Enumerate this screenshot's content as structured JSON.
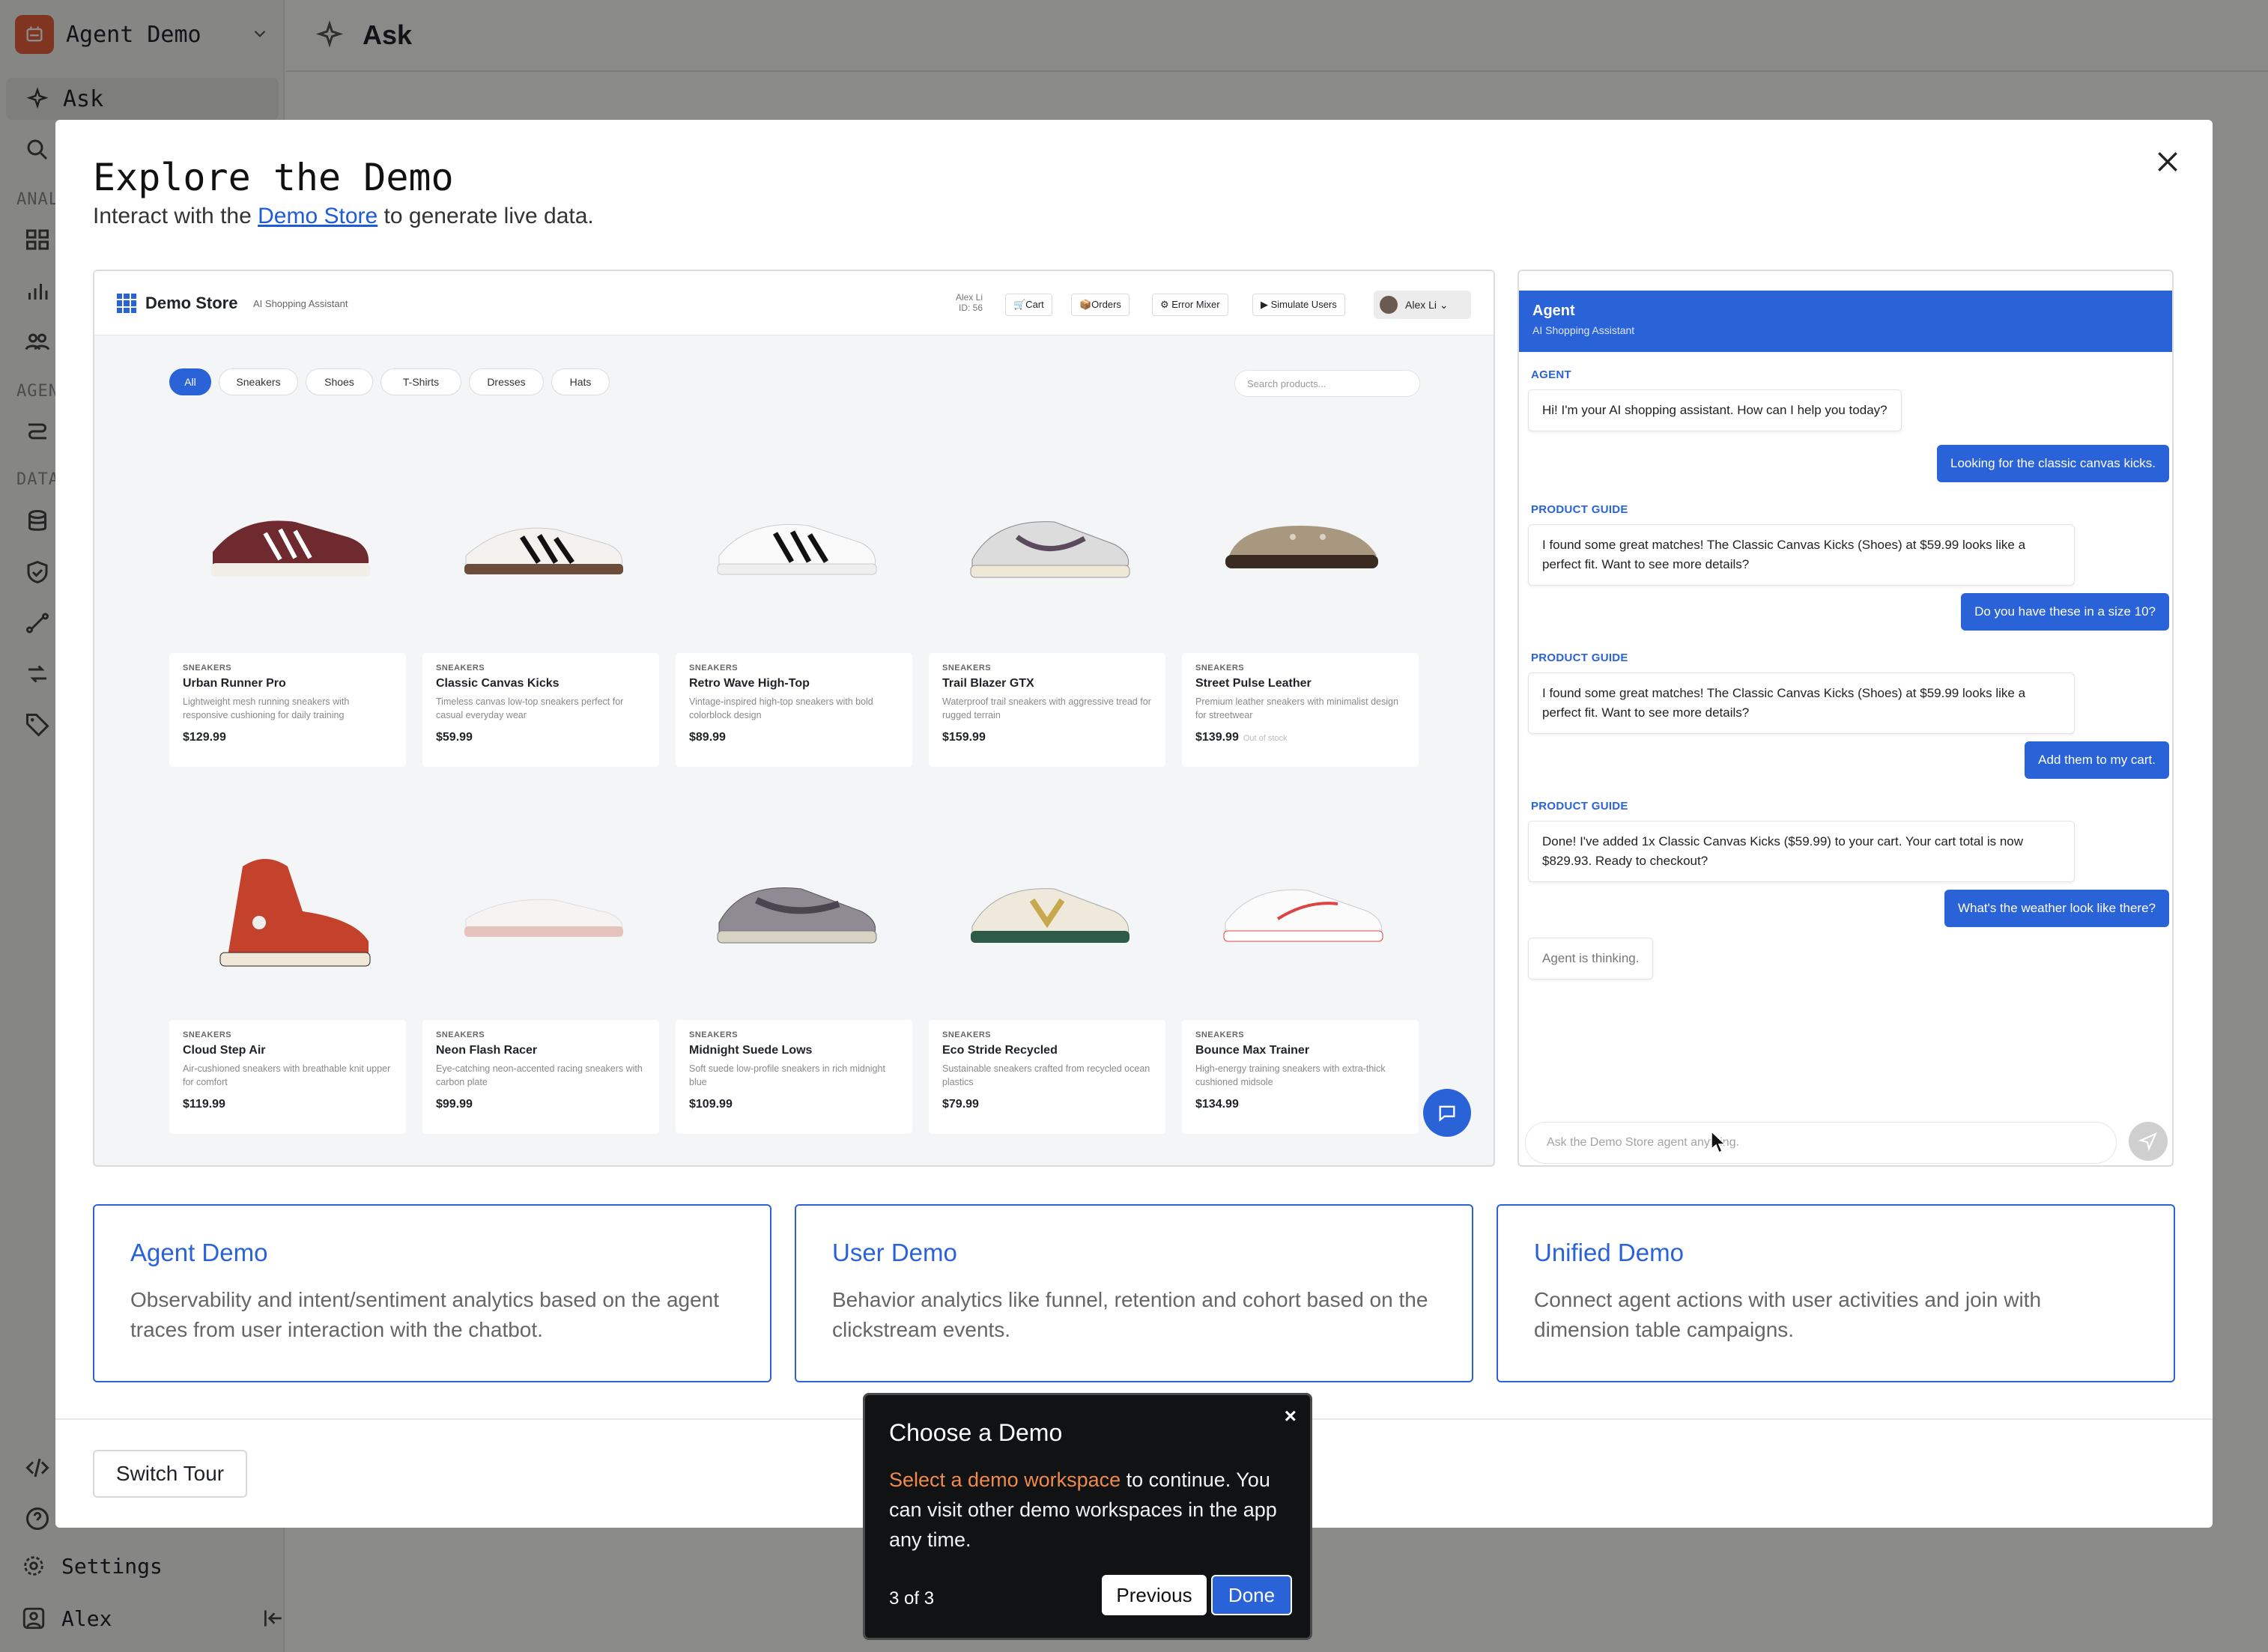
{
  "app": {
    "workspace_name": "Agent Demo",
    "page_title": "Ask",
    "sidebar": {
      "ask_label": "Ask",
      "section_analytics": "ANAL",
      "section_agents": "AGEN",
      "section_data": "DATA",
      "settings_label": "Settings",
      "user_name": "Alex"
    }
  },
  "modal": {
    "title": "Explore the Demo",
    "subtitle_prefix": "Interact with the",
    "subtitle_link": "Demo Store",
    "subtitle_suffix": "to generate live data.",
    "switch_tour_label": "Switch Tour"
  },
  "store": {
    "name": "Demo Store",
    "tagline": "AI Shopping Assistant",
    "user_info_name": "Alex Li",
    "user_info_id": "ID: 56",
    "buttons": [
      "🛒Cart",
      "📦Orders",
      "⚙ Error Mixer",
      "▶ Simulate Users"
    ],
    "profile_name": "Alex Li ⌄",
    "categories": [
      "All",
      "Sneakers",
      "Shoes",
      "T-Shirts",
      "Dresses",
      "Hats"
    ],
    "search_placeholder": "Search products...",
    "products": [
      {
        "category": "SNEAKERS",
        "name": "Urban Runner Pro",
        "desc": "Lightweight mesh running sneakers with responsive cushioning for daily training",
        "price": "$129.99",
        "stock": ""
      },
      {
        "category": "SNEAKERS",
        "name": "Classic Canvas Kicks",
        "desc": "Timeless canvas low-top sneakers perfect for casual everyday wear",
        "price": "$59.99",
        "stock": ""
      },
      {
        "category": "SNEAKERS",
        "name": "Retro Wave High-Top",
        "desc": "Vintage-inspired high-top sneakers with bold colorblock design",
        "price": "$89.99",
        "stock": ""
      },
      {
        "category": "SNEAKERS",
        "name": "Trail Blazer GTX",
        "desc": "Waterproof trail sneakers with aggressive tread for rugged terrain",
        "price": "$159.99",
        "stock": ""
      },
      {
        "category": "SNEAKERS",
        "name": "Street Pulse Leather",
        "desc": "Premium leather sneakers with minimalist design for streetwear",
        "price": "$139.99",
        "stock": "Out of stock"
      },
      {
        "category": "SNEAKERS",
        "name": "Cloud Step Air",
        "desc": "Air-cushioned sneakers with breathable knit upper for comfort",
        "price": "$119.99",
        "stock": ""
      },
      {
        "category": "SNEAKERS",
        "name": "Neon Flash Racer",
        "desc": "Eye-catching neon-accented racing sneakers with carbon plate",
        "price": "$99.99",
        "stock": ""
      },
      {
        "category": "SNEAKERS",
        "name": "Midnight Suede Lows",
        "desc": "Soft suede low-profile sneakers in rich midnight blue",
        "price": "$109.99",
        "stock": ""
      },
      {
        "category": "SNEAKERS",
        "name": "Eco Stride Recycled",
        "desc": "Sustainable sneakers crafted from recycled ocean plastics",
        "price": "$79.99",
        "stock": ""
      },
      {
        "category": "SNEAKERS",
        "name": "Bounce Max Trainer",
        "desc": "High-energy training sneakers with extra-thick cushioned midsole",
        "price": "$134.99",
        "stock": ""
      }
    ]
  },
  "chat": {
    "header_title": "Agent",
    "header_sub": "AI Shopping Assistant",
    "label_agent": "AGENT",
    "label_guide": "PRODUCT GUIDE",
    "m1": "Hi! I'm your AI shopping assistant. How can I help you today?",
    "u1": "Looking for the classic canvas kicks.",
    "m2": "I found some great matches! The Classic Canvas Kicks (Shoes) at $59.99 looks like a perfect fit. Want to see more details?",
    "u2": "Do you have these in a size 10?",
    "m3": "I found some great matches! The Classic Canvas Kicks (Shoes) at $59.99 looks like a perfect fit. Want to see more details?",
    "u3": "Add them to my cart.",
    "m4": "Done! I've added 1x Classic Canvas Kicks ($59.99) to your cart. Your cart total is now $829.93. Ready to checkout?",
    "u4": "What's the weather look like there?",
    "thinking": "Agent is thinking.",
    "input_placeholder": "Ask the Demo Store agent anything."
  },
  "demos": [
    {
      "title": "Agent Demo",
      "desc": "Observability and intent/sentiment analytics based on the agent traces from user interaction with the chatbot."
    },
    {
      "title": "User Demo",
      "desc": "Behavior analytics like funnel, retention and cohort based on the clickstream events."
    },
    {
      "title": "Unified Demo",
      "desc": "Connect agent actions with user activities and join with dimension table campaigns."
    }
  ],
  "tour": {
    "title": "Choose a Demo",
    "highlight": "Select a demo workspace",
    "body_rest": " to continue. You can visit other demo workspaces in the app any time.",
    "step": "3 of 3",
    "prev_label": "Previous",
    "done_label": "Done",
    "close_glyph": "×"
  },
  "colors": {
    "accent": "#2a62d8",
    "brand": "#e8613a",
    "tour_highlight": "#f08a4b"
  }
}
